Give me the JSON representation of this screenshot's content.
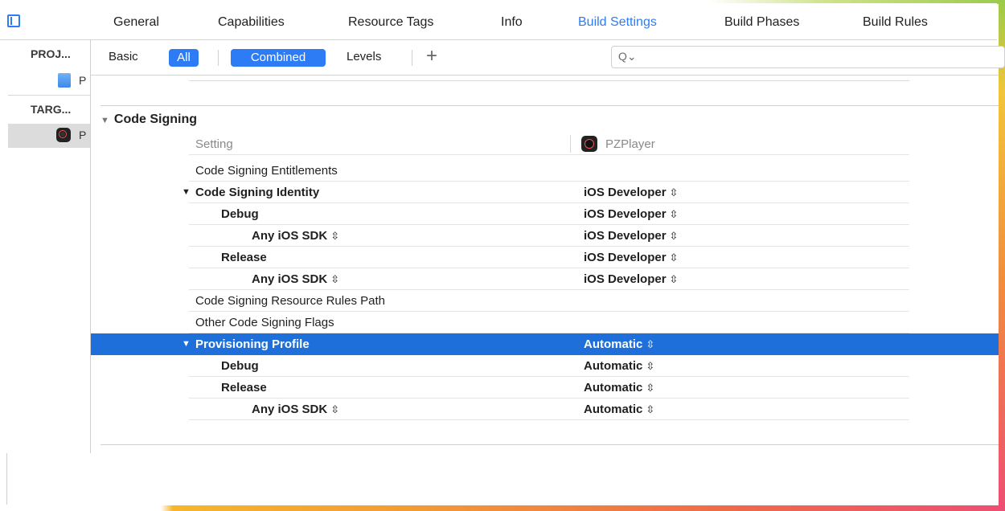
{
  "tabs": [
    {
      "label": "General",
      "active": false
    },
    {
      "label": "Capabilities",
      "active": false
    },
    {
      "label": "Resource Tags",
      "active": false
    },
    {
      "label": "Info",
      "active": false
    },
    {
      "label": "Build Settings",
      "active": true
    },
    {
      "label": "Build Phases",
      "active": false
    },
    {
      "label": "Build Rules",
      "active": false
    }
  ],
  "navigator": {
    "project_section": "PROJ...",
    "project_item": "P",
    "targets_section": "TARG...",
    "target_item": "P"
  },
  "filter": {
    "basic": "Basic",
    "all": "All",
    "combined": "Combined",
    "levels": "Levels",
    "plus": "+",
    "search_placeholder": ""
  },
  "section": {
    "title": "Code Signing",
    "column_header": "Setting",
    "target_name": "PZPlayer"
  },
  "rows": [
    {
      "name": "Code Signing Entitlements",
      "value": "",
      "level": 0,
      "bold": false,
      "expander": false,
      "name_updown": false,
      "value_updown": false
    },
    {
      "name": "Code Signing Identity",
      "value": "iOS Developer",
      "level": 0,
      "bold": true,
      "expander": true,
      "name_updown": false,
      "value_updown": true
    },
    {
      "name": "Debug",
      "value": "iOS Developer",
      "level": 1,
      "bold": true,
      "expander": false,
      "name_updown": false,
      "value_updown": true
    },
    {
      "name": "Any iOS SDK",
      "value": "iOS Developer",
      "level": 2,
      "bold": true,
      "expander": false,
      "name_updown": true,
      "value_updown": true
    },
    {
      "name": "Release",
      "value": "iOS Developer",
      "level": 1,
      "bold": true,
      "expander": false,
      "name_updown": false,
      "value_updown": true
    },
    {
      "name": "Any iOS SDK",
      "value": "iOS Developer",
      "level": 2,
      "bold": true,
      "expander": false,
      "name_updown": true,
      "value_updown": true
    },
    {
      "name": "Code Signing Resource Rules Path",
      "value": "",
      "level": 0,
      "bold": false,
      "expander": false,
      "name_updown": false,
      "value_updown": false
    },
    {
      "name": "Other Code Signing Flags",
      "value": "",
      "level": 0,
      "bold": false,
      "expander": false,
      "name_updown": false,
      "value_updown": false
    },
    {
      "name": "Provisioning Profile",
      "value": "Automatic",
      "level": 0,
      "bold": true,
      "expander": true,
      "selected": true,
      "name_updown": false,
      "value_updown": true
    },
    {
      "name": "Debug",
      "value": "Automatic",
      "level": 1,
      "bold": true,
      "expander": false,
      "name_updown": false,
      "value_updown": true
    },
    {
      "name": "Release",
      "value": "Automatic",
      "level": 1,
      "bold": true,
      "expander": false,
      "name_updown": false,
      "value_updown": true
    },
    {
      "name": "Any iOS SDK",
      "value": "Automatic",
      "level": 2,
      "bold": true,
      "expander": false,
      "name_updown": true,
      "value_updown": true
    }
  ],
  "glyphs": {
    "expander": "▼",
    "updown": "⌃⌄"
  },
  "colors": {
    "accent": "#2d7cf6",
    "selection": "#1e6fd9"
  }
}
